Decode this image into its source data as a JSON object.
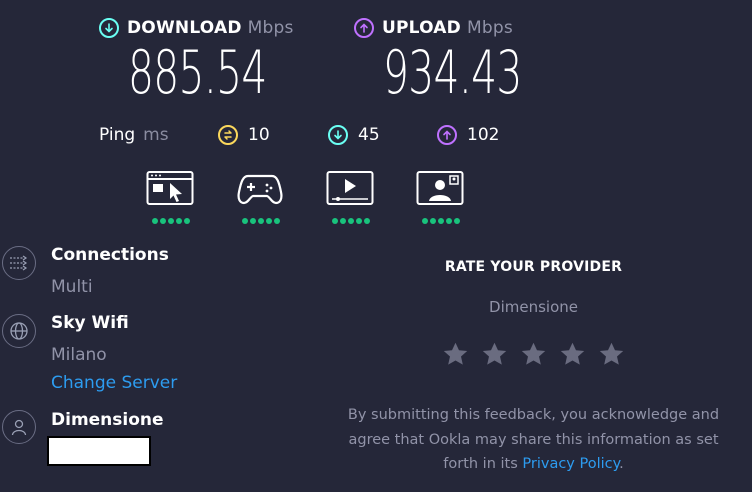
{
  "download": {
    "label": "DOWNLOAD",
    "unit": "Mbps",
    "value": "885.54",
    "icon": "download-arrow-icon",
    "color": "#6afff3"
  },
  "upload": {
    "label": "UPLOAD",
    "unit": "Mbps",
    "value": "934.43",
    "icon": "upload-arrow-icon",
    "color": "#bf71ff"
  },
  "ping": {
    "label": "Ping",
    "unit": "ms",
    "idle": {
      "value": "10",
      "icon": "idle-latency-icon",
      "color": "#fbd85c"
    },
    "download": {
      "value": "45",
      "icon": "download-latency-icon",
      "color": "#6afff3"
    },
    "upload": {
      "value": "102",
      "icon": "upload-latency-icon",
      "color": "#bf71ff"
    }
  },
  "experience": [
    {
      "name": "web-browsing-icon",
      "rating": 5
    },
    {
      "name": "gaming-icon",
      "rating": 5
    },
    {
      "name": "video-streaming-icon",
      "rating": 5
    },
    {
      "name": "video-chat-icon",
      "rating": 5
    }
  ],
  "connections": {
    "title": "Connections",
    "value": "Multi",
    "icon": "connections-icon"
  },
  "server": {
    "title": "Sky Wifi",
    "location": "Milano",
    "change_label": "Change Server",
    "icon": "globe-icon"
  },
  "provider": {
    "title": "Dimensione",
    "icon": "user-icon"
  },
  "rate": {
    "title": "RATE YOUR PROVIDER",
    "provider": "Dimensione",
    "stars": 5,
    "disclaimer_line1": "By submitting this feedback, you acknowledge and",
    "disclaimer_line2": "agree that Ookla may share this information as set",
    "disclaimer_prefix": "forth in its ",
    "privacy_link": "Privacy Policy",
    "disclaimer_suffix": "."
  },
  "colors": {
    "background": "#252739",
    "rating_dot": "#19c37d",
    "link": "#2d9cf0",
    "star": "#6a6c80"
  }
}
